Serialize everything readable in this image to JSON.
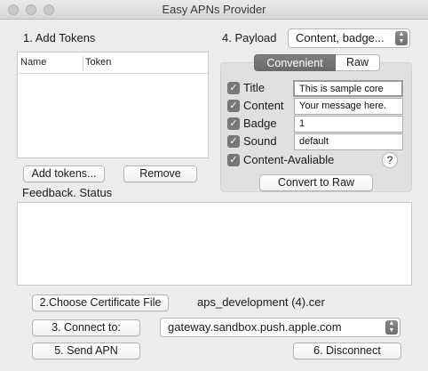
{
  "window": {
    "title": "Easy APNs Provider"
  },
  "tokens": {
    "section_label": "1. Add Tokens",
    "columns": [
      "Name",
      "Token"
    ],
    "add_button": "Add tokens...",
    "remove_button": "Remove"
  },
  "payload": {
    "label": "4. Payload",
    "popup_value": "Content, badge...",
    "tabs": [
      "Convenient",
      "Raw"
    ],
    "fields": [
      {
        "label": "Title",
        "checked": true,
        "value": "This is sample core"
      },
      {
        "label": "Content",
        "checked": true,
        "value": "Your message here."
      },
      {
        "label": "Badge",
        "checked": true,
        "value": "1"
      },
      {
        "label": "Sound",
        "checked": true,
        "value": "default"
      }
    ],
    "content_available": {
      "label": "Content-Avaliable",
      "checked": true
    },
    "help": "?",
    "convert_button": "Convert to Raw"
  },
  "feedback": {
    "label": "Feedback. Status"
  },
  "certificate": {
    "button": "2.Choose Certificate File",
    "file": "aps_development (4).cer"
  },
  "connection": {
    "button": "3. Connect to:",
    "server": "gateway.sandbox.push.apple.com"
  },
  "actions": {
    "send": "5. Send APN",
    "disconnect": "6. Disconnect"
  }
}
